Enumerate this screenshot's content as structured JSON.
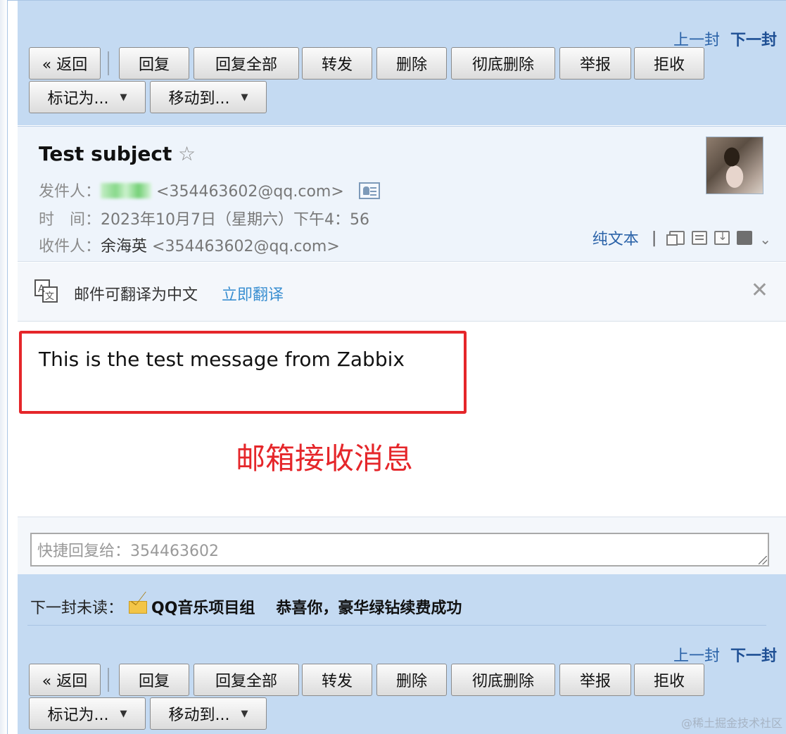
{
  "toolbar": {
    "prev_label": "上一封",
    "next_label": "下一封",
    "back_label": "« 返回",
    "reply_label": "回复",
    "reply_all_label": "回复全部",
    "forward_label": "转发",
    "delete_label": "删除",
    "delete_permanent_label": "彻底删除",
    "report_label": "举报",
    "reject_label": "拒收",
    "mark_as_label": "标记为...",
    "move_to_label": "移动到..."
  },
  "mail": {
    "subject": "Test subject",
    "star_glyph": "☆",
    "from_label": "发件人：",
    "from_email": "<354463602@qq.com>",
    "time_label": "时　间：",
    "time_value": "2023年10月7日（星期六）下午4：56",
    "to_label": "收件人：",
    "to_name": "余海英",
    "to_email": "<354463602@qq.com>",
    "plain_text_link": "纯文本",
    "tools_separator": "|"
  },
  "translate": {
    "text": "邮件可翻译为中文",
    "link": "立即翻译",
    "close_glyph": "✕"
  },
  "body": {
    "message": "This is the test message from Zabbix",
    "annotation": "邮箱接收消息"
  },
  "quick_reply": {
    "placeholder": "快捷回复给：354463602"
  },
  "next_unread": {
    "label": "下一封未读：",
    "from": "QQ音乐项目组",
    "subject": "恭喜你，豪华绿钻续费成功"
  },
  "watermark": "@稀土掘金技术社区",
  "colors": {
    "toolbar_bg": "#c4daf2",
    "link_blue": "#2a62a8",
    "annotation_red": "#e5262a"
  }
}
